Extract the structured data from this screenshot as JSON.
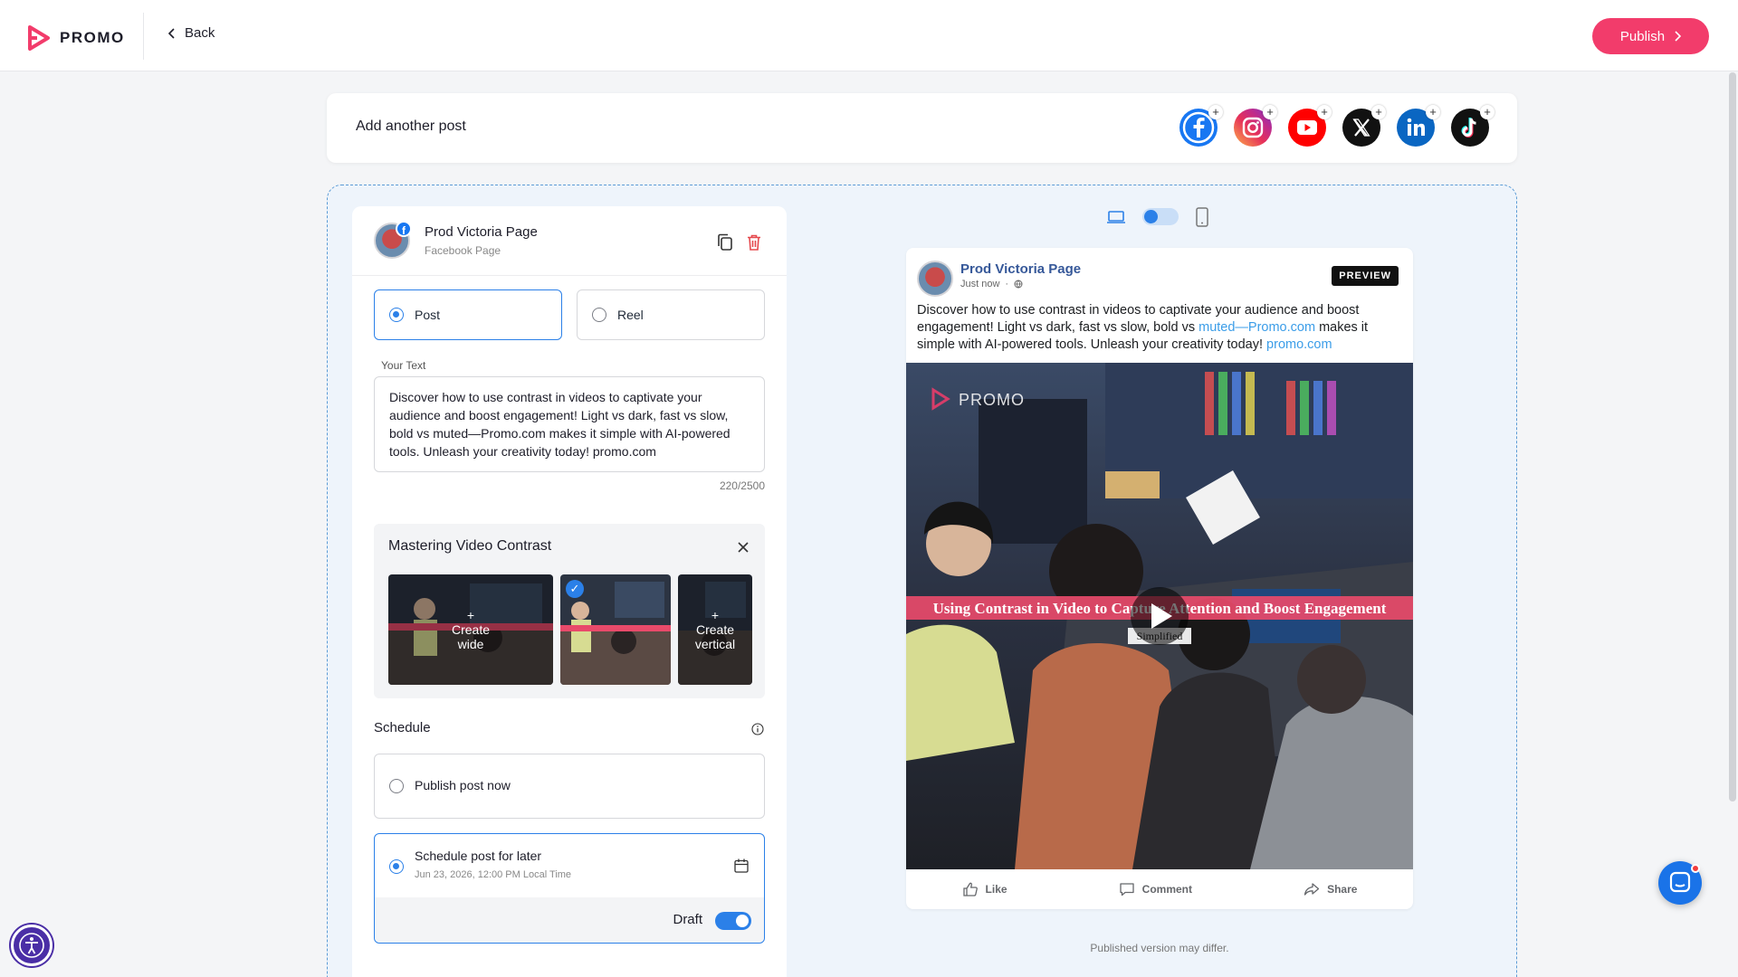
{
  "header": {
    "logo_text": "PROMO",
    "back_label": "Back",
    "publish_label": "Publish"
  },
  "add_post": {
    "label": "Add another post",
    "networks": [
      "facebook",
      "instagram",
      "youtube",
      "x",
      "linkedin",
      "tiktok"
    ]
  },
  "account": {
    "name": "Prod Victoria Page",
    "subtitle": "Facebook Page"
  },
  "post_type": {
    "options": [
      "Post",
      "Reel"
    ],
    "selected": "Post"
  },
  "text": {
    "label": "Your Text",
    "value": "Discover how to use contrast in videos to captivate your audience and boost engagement! Light vs dark, fast vs slow, bold vs muted—Promo.com makes it simple with AI-powered tools. Unleash your creativity today! promo.com",
    "count": "220/2500"
  },
  "media": {
    "title": "Mastering Video Contrast",
    "create_wide": "Create wide",
    "create_vertical": "Create vertical",
    "video_caption": "Using Contrast in Video to Capture Attention and Boost Engagement"
  },
  "schedule": {
    "label": "Schedule",
    "now_label": "Publish post now",
    "later_label": "Schedule post for later",
    "later_date": "Jun 23, 2026, 12:00 PM Local Time",
    "selected": "later",
    "draft_label": "Draft",
    "draft_on": true
  },
  "preview": {
    "page_name": "Prod Victoria Page",
    "time": "Just now",
    "badge": "PREVIEW",
    "text_part1": "Discover how to use contrast in videos to captivate your audience and boost engagement! Light vs dark, fast vs slow, bold vs ",
    "link1": "muted—Promo.com",
    "text_part2": " makes it simple with AI-powered tools. Unleash your creativity today! ",
    "link2": "promo.com",
    "watermark": "PROMO",
    "sub_caption": "Simplified",
    "actions": [
      "Like",
      "Comment",
      "Share"
    ],
    "note": "Published version may differ."
  },
  "colors": {
    "brand": "#f23c6b",
    "accent": "#2b80e8"
  }
}
